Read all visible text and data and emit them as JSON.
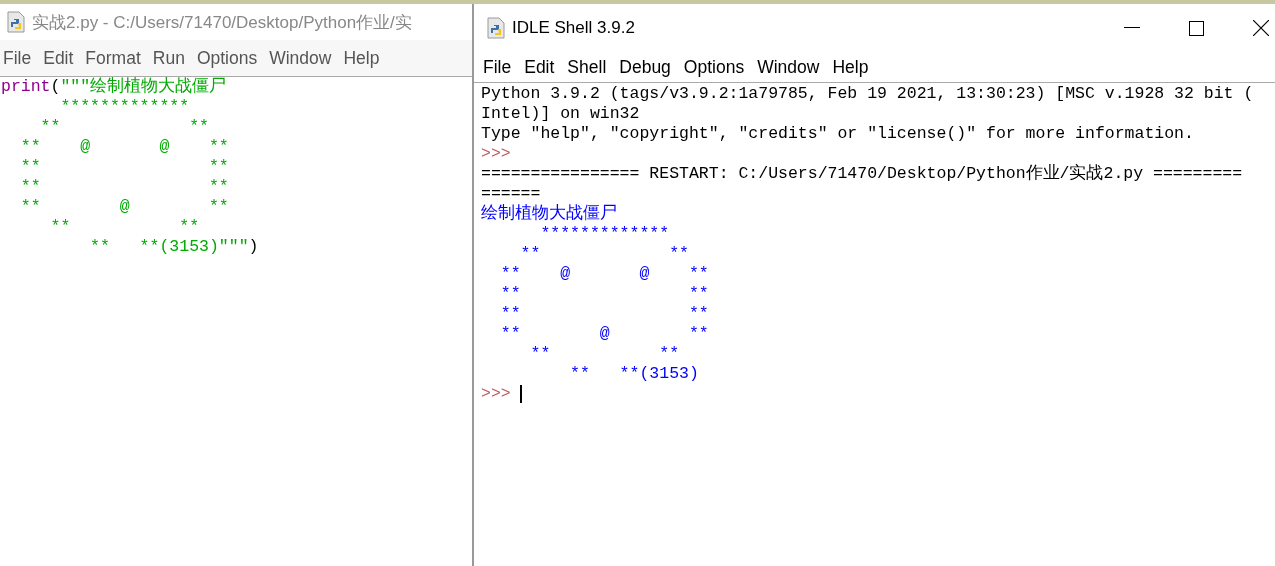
{
  "editor": {
    "title": "实战2.py - C:/Users/71470/Desktop/Python作业/实",
    "menu": [
      "File",
      "Edit",
      "Format",
      "Run",
      "Options",
      "Window",
      "Help"
    ],
    "lines": [
      [
        {
          "kind": "builtin",
          "text": "print"
        },
        {
          "kind": "plain",
          "text": "("
        },
        {
          "kind": "string",
          "text": "\"\"\"绘制植物大战僵尸"
        }
      ],
      [
        {
          "kind": "string",
          "text": "      *************"
        }
      ],
      [
        {
          "kind": "string",
          "text": "    **             **"
        }
      ],
      [
        {
          "kind": "string",
          "text": "  **    @       @    **"
        }
      ],
      [
        {
          "kind": "string",
          "text": "  **                 **"
        }
      ],
      [
        {
          "kind": "string",
          "text": "  **                 **"
        }
      ],
      [
        {
          "kind": "string",
          "text": "  **        @        **"
        }
      ],
      [
        {
          "kind": "string",
          "text": "     **           **"
        }
      ],
      [
        {
          "kind": "string",
          "text": "         **   **(3153)\"\"\""
        },
        {
          "kind": "plain",
          "text": ")"
        }
      ]
    ]
  },
  "shell": {
    "title": "IDLE Shell 3.9.2",
    "menu": [
      "File",
      "Edit",
      "Shell",
      "Debug",
      "Options",
      "Window",
      "Help"
    ],
    "lines": [
      {
        "kind": "console",
        "text": "Python 3.9.2 (tags/v3.9.2:1a79785, Feb 19 2021, 13:30:23) [MSC v.1928 32 bit ("
      },
      {
        "kind": "console",
        "text": "Intel)] on win32"
      },
      {
        "kind": "console",
        "text": "Type \"help\", \"copyright\", \"credits\" or \"license()\" for more information."
      },
      {
        "kind": "prompt",
        "text": ">>>"
      },
      {
        "kind": "console",
        "text": "================ RESTART: C:/Users/71470/Desktop/Python作业/实战2.py ========="
      },
      {
        "kind": "console",
        "text": "======"
      },
      {
        "kind": "output",
        "text": "绘制植物大战僵尸"
      },
      {
        "kind": "output",
        "text": "      *************"
      },
      {
        "kind": "output",
        "text": "    **             **"
      },
      {
        "kind": "output",
        "text": "  **    @       @    **"
      },
      {
        "kind": "output",
        "text": "  **                 **"
      },
      {
        "kind": "output",
        "text": "  **                 **"
      },
      {
        "kind": "output",
        "text": "  **        @        **"
      },
      {
        "kind": "output",
        "text": "     **           **"
      },
      {
        "kind": "output",
        "text": "         **   **(3153)"
      },
      {
        "kind": "input",
        "text": ">>>"
      }
    ]
  }
}
